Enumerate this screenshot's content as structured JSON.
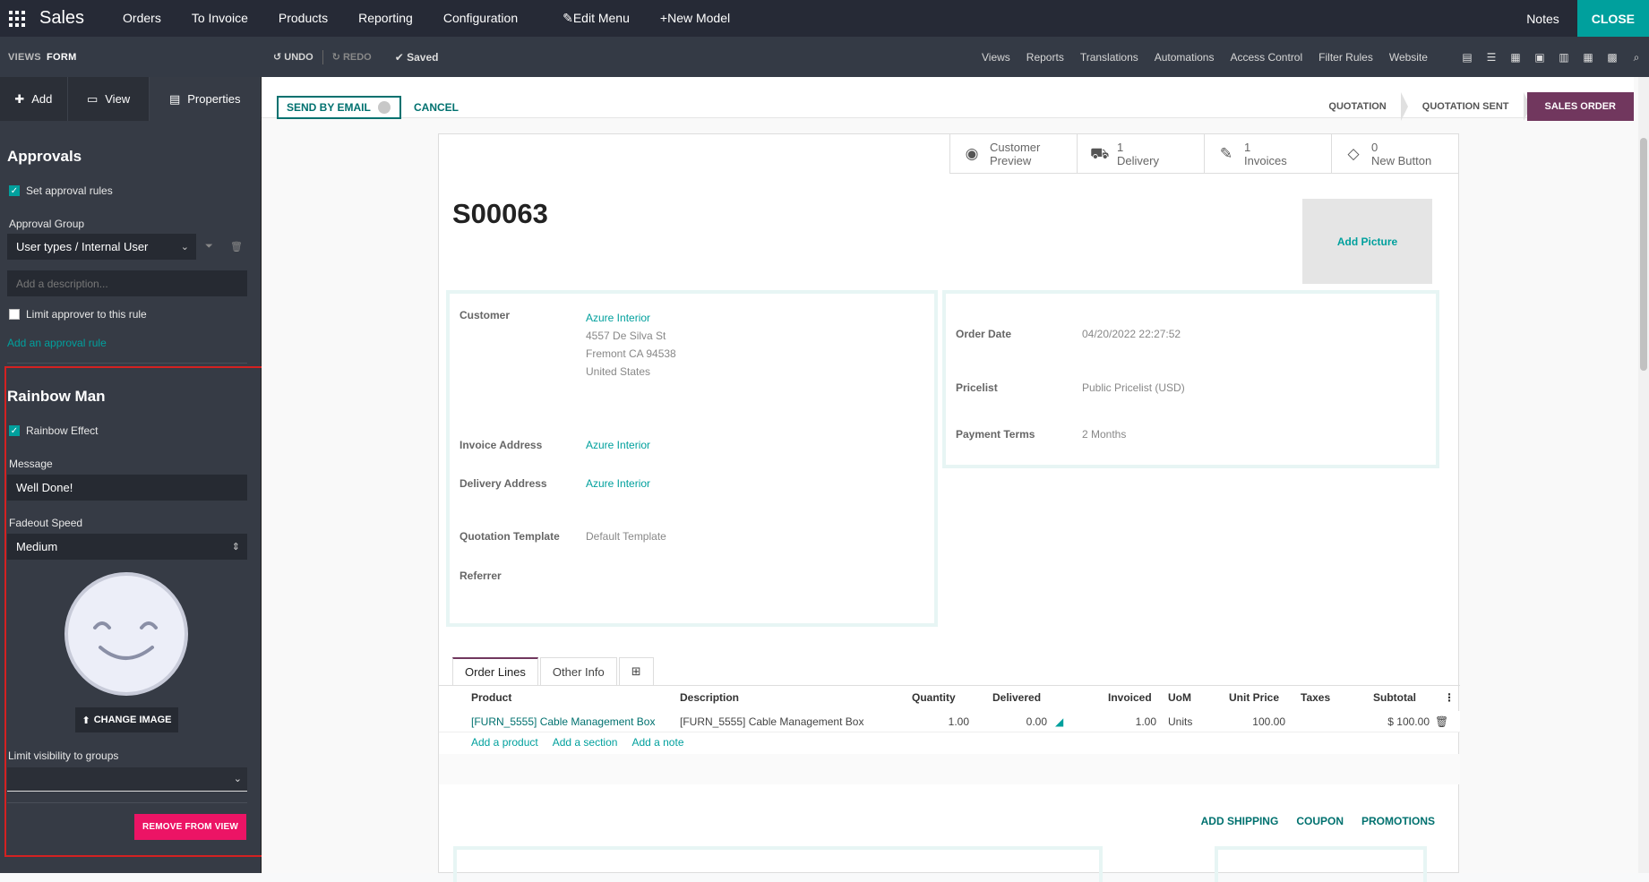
{
  "topbar": {
    "app_name": "Sales",
    "menu": [
      "Orders",
      "To Invoice",
      "Products",
      "Reporting",
      "Configuration"
    ],
    "edit_menu": "Edit Menu",
    "new_model": "New Model",
    "notes": "Notes",
    "close": "CLOSE"
  },
  "studiobar": {
    "views": "VIEWS",
    "form": "FORM",
    "undo": "UNDO",
    "redo": "REDO",
    "saved": "Saved",
    "menu": [
      "Views",
      "Reports",
      "Translations",
      "Automations",
      "Access Control",
      "Filter Rules",
      "Website"
    ]
  },
  "sidebar": {
    "tabs": [
      "Add",
      "View",
      "Properties"
    ],
    "approvals_title": "Approvals",
    "set_approval_rules": "Set approval rules",
    "approval_group_label": "Approval Group",
    "approval_group_value": "User types / Internal User",
    "description_placeholder": "Add a description...",
    "limit_approver": "Limit approver to this rule",
    "add_rule": "Add an approval rule",
    "rainbow_title": "Rainbow Man",
    "rainbow_effect": "Rainbow Effect",
    "message_label": "Message",
    "message_value": "Well Done!",
    "fadeout_label": "Fadeout Speed",
    "fadeout_value": "Medium",
    "change_image": "CHANGE IMAGE",
    "limit_visibility": "Limit visibility to groups",
    "remove": "REMOVE FROM VIEW"
  },
  "form": {
    "send_by_email": "SEND BY EMAIL",
    "cancel": "CANCEL",
    "stages": [
      "QUOTATION",
      "QUOTATION SENT",
      "SALES ORDER"
    ],
    "smart_buttons": [
      {
        "line1": "Customer",
        "line2": "Preview"
      },
      {
        "line1": "1",
        "line2": "Delivery"
      },
      {
        "line1": "1",
        "line2": "Invoices"
      },
      {
        "line1": "0",
        "line2": "New Button"
      }
    ],
    "order_name": "S00063",
    "add_picture": "Add Picture",
    "customer_label": "Customer",
    "customer_name": "Azure Interior",
    "customer_addr1": "4557 De Silva St",
    "customer_addr2": "Fremont CA 94538",
    "customer_addr3": "United States",
    "invoice_address_label": "Invoice Address",
    "invoice_address": "Azure Interior",
    "delivery_address_label": "Delivery Address",
    "delivery_address": "Azure Interior",
    "quotation_template_label": "Quotation Template",
    "quotation_template": "Default Template",
    "referrer_label": "Referrer",
    "order_date_label": "Order Date",
    "order_date": "04/20/2022 22:27:52",
    "pricelist_label": "Pricelist",
    "pricelist": "Public Pricelist (USD)",
    "payment_terms_label": "Payment Terms",
    "payment_terms": "2 Months",
    "tabs": [
      "Order Lines",
      "Other Info"
    ],
    "columns": [
      "Product",
      "Description",
      "Quantity",
      "Delivered",
      "Invoiced",
      "UoM",
      "Unit Price",
      "Taxes",
      "Subtotal"
    ],
    "line": {
      "product": "[FURN_5555] Cable Management Box",
      "description": "[FURN_5555] Cable Management Box",
      "quantity": "1.00",
      "delivered": "0.00",
      "invoiced": "1.00",
      "uom": "Units",
      "unit_price": "100.00",
      "taxes": "",
      "subtotal": "$ 100.00"
    },
    "add_product": "Add a product",
    "add_section": "Add a section",
    "add_note": "Add a note",
    "add_shipping": "ADD SHIPPING",
    "coupon": "COUPON",
    "promotions": "PROMOTIONS"
  }
}
